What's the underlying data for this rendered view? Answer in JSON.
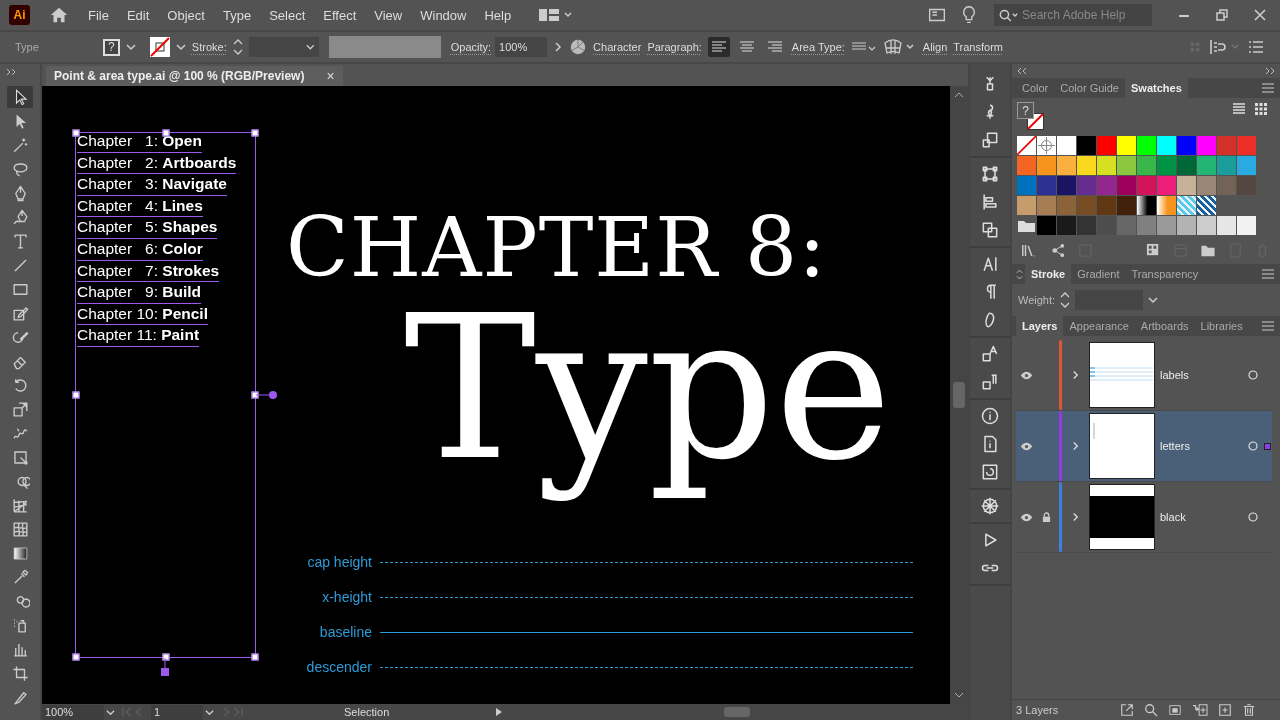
{
  "app_menu": {
    "logo": "Ai",
    "items": [
      "File",
      "Edit",
      "Object",
      "Type",
      "Select",
      "Effect",
      "View",
      "Window",
      "Help"
    ]
  },
  "help_search": {
    "placeholder": "Search Adobe Help"
  },
  "control_bar": {
    "selection_label": "Type",
    "fill_swatch": "?",
    "stroke_label": "Stroke:",
    "opacity_label": "Opacity:",
    "opacity_value": "100%",
    "character": "Character",
    "paragraph_label": "Paragraph:",
    "alignments": [
      {
        "kind": "left",
        "selected": true
      },
      {
        "kind": "center",
        "selected": false
      },
      {
        "kind": "right",
        "selected": false
      }
    ],
    "area_type_label": "Area Type:",
    "align": "Align",
    "transform": "Transform"
  },
  "document_tab": {
    "title": "Point & area type.ai @ 100 % (RGB/Preview)",
    "close": "×"
  },
  "tools": [
    {
      "kind": "selection",
      "selected": true
    },
    {
      "kind": "direct",
      "selected": false
    },
    {
      "kind": "wand",
      "selected": false
    },
    {
      "kind": "lasso",
      "selected": false
    },
    {
      "kind": "pen",
      "selected": false
    },
    {
      "kind": "curvature",
      "selected": false
    },
    {
      "kind": "type",
      "selected": false
    },
    {
      "kind": "line",
      "selected": false
    },
    {
      "kind": "rectangle",
      "selected": false
    },
    {
      "kind": "shaper",
      "selected": false
    },
    {
      "kind": "blob",
      "selected": false
    },
    {
      "kind": "eraser",
      "selected": false
    },
    {
      "kind": "rotate",
      "selected": false
    },
    {
      "kind": "scale",
      "selected": false
    },
    {
      "kind": "warp",
      "selected": false
    },
    {
      "kind": "transform",
      "selected": false
    },
    {
      "kind": "builder",
      "selected": false
    },
    {
      "kind": "perspective",
      "selected": false
    },
    {
      "kind": "mesh",
      "selected": false
    },
    {
      "kind": "gradient",
      "selected": false
    },
    {
      "kind": "eyedropper",
      "selected": false
    },
    {
      "kind": "blend",
      "selected": false
    },
    {
      "kind": "sprayer",
      "selected": false
    },
    {
      "kind": "graph",
      "selected": false
    },
    {
      "kind": "artboard",
      "selected": false
    },
    {
      "kind": "knife",
      "selected": false
    }
  ],
  "canvas": {
    "chapters": [
      "Chapter   1: **Open**",
      "Chapter   2: **Artboards**",
      "Chapter   3: **Navigate**",
      "Chapter   4: **Lines**",
      "Chapter   5: **Shapes**",
      "Chapter   6: **Color**",
      "Chapter   7: **Strokes**",
      "Chapter   9: **Build**",
      "Chapter 10: **Pencil**",
      "Chapter 11: **Paint**"
    ],
    "heading": "CHAPTER 8:",
    "title": "Type",
    "guides": [
      {
        "label": "cap height",
        "kind": "dashed"
      },
      {
        "label": "x-height",
        "kind": "dashed"
      },
      {
        "label": "baseline",
        "kind": "solid"
      },
      {
        "label": "descender",
        "kind": "dashed"
      }
    ]
  },
  "panels": {
    "color_tabs": [
      {
        "label": "Color",
        "selected": false
      },
      {
        "label": "Color Guide",
        "selected": false
      },
      {
        "label": "Swatches",
        "selected": true
      }
    ],
    "fill_swatch": "?",
    "swatches": [
      [
        {
          "kind": "none"
        },
        {
          "kind": "registration"
        },
        {
          "kind": "color",
          "color": "#ffffff"
        },
        {
          "kind": "color",
          "color": "#000000"
        },
        {
          "kind": "color",
          "color": "#ff0000"
        },
        {
          "kind": "color",
          "color": "#ffff00"
        },
        {
          "kind": "color",
          "color": "#00ff00"
        },
        {
          "kind": "color",
          "color": "#00ffff"
        },
        {
          "kind": "color",
          "color": "#0000ff"
        },
        {
          "kind": "color",
          "color": "#ff00ff"
        },
        {
          "kind": "color",
          "color": "#d4302a"
        },
        {
          "kind": "color",
          "color": "#ec2f27"
        }
      ],
      [
        {
          "kind": "color",
          "color": "#f26522"
        },
        {
          "kind": "color",
          "color": "#f7941d"
        },
        {
          "kind": "color",
          "color": "#fbaf3f"
        },
        {
          "kind": "color",
          "color": "#f9d71c"
        },
        {
          "kind": "color",
          "color": "#d7df23"
        },
        {
          "kind": "color",
          "color": "#8dc63f"
        },
        {
          "kind": "color",
          "color": "#39b54a"
        },
        {
          "kind": "color",
          "color": "#009245"
        },
        {
          "kind": "color",
          "color": "#006837"
        },
        {
          "kind": "color",
          "color": "#22b573"
        },
        {
          "kind": "color",
          "color": "#1b9e9b"
        },
        {
          "kind": "color",
          "color": "#29abe2"
        }
      ],
      [
        {
          "kind": "color",
          "color": "#0071bc"
        },
        {
          "kind": "color",
          "color": "#2e3192"
        },
        {
          "kind": "color",
          "color": "#1b1464"
        },
        {
          "kind": "color",
          "color": "#662d91"
        },
        {
          "kind": "color",
          "color": "#93278f"
        },
        {
          "kind": "color",
          "color": "#9e005d"
        },
        {
          "kind": "color",
          "color": "#d4145a"
        },
        {
          "kind": "color",
          "color": "#ed1e79"
        },
        {
          "kind": "color",
          "color": "#c7b299"
        },
        {
          "kind": "color",
          "color": "#998675"
        },
        {
          "kind": "color",
          "color": "#736357"
        },
        {
          "kind": "color",
          "color": "#534741"
        }
      ],
      [
        {
          "kind": "color",
          "color": "#c69c6d"
        },
        {
          "kind": "color",
          "color": "#a67c52"
        },
        {
          "kind": "color",
          "color": "#8c6239"
        },
        {
          "kind": "color",
          "color": "#754c24"
        },
        {
          "kind": "color",
          "color": "#603813"
        },
        {
          "kind": "color",
          "color": "#42210b"
        },
        {
          "kind": "gradient",
          "color": "#000000"
        },
        {
          "kind": "gradient",
          "color": "#f7941d"
        },
        {
          "kind": "pattern",
          "color": "#5bc8ef"
        },
        {
          "kind": "pattern",
          "color": "#1b5e9e"
        }
      ],
      [
        {
          "kind": "folder"
        },
        {
          "kind": "color",
          "color": "#000000"
        },
        {
          "kind": "color",
          "color": "#1a1a1a"
        },
        {
          "kind": "color",
          "color": "#333333"
        },
        {
          "kind": "color",
          "color": "#4d4d4d"
        },
        {
          "kind": "color",
          "color": "#666666"
        },
        {
          "kind": "color",
          "color": "#808080"
        },
        {
          "kind": "color",
          "color": "#999999"
        },
        {
          "kind": "color",
          "color": "#b3b3b3"
        },
        {
          "kind": "color",
          "color": "#cccccc"
        },
        {
          "kind": "color",
          "color": "#e6e6e6"
        },
        {
          "kind": "color",
          "color": "#f2f2f2"
        }
      ]
    ],
    "stroke_tabs": [
      {
        "label": "Stroke",
        "selected": true
      },
      {
        "label": "Gradient",
        "selected": false
      },
      {
        "label": "Transparency",
        "selected": false
      }
    ],
    "weight_label": "Weight:",
    "layer_tabs": [
      {
        "label": "Layers",
        "selected": true
      },
      {
        "label": "Appearance",
        "selected": false
      },
      {
        "label": "Artboards",
        "selected": false
      },
      {
        "label": "Libraries",
        "selected": false
      }
    ],
    "layers": [
      {
        "name": "labels",
        "color": "#e2553b",
        "visible": true,
        "locked": false,
        "selected": false,
        "art_selected": false,
        "kind": "lines"
      },
      {
        "name": "letters",
        "color": "#8f3fe0",
        "visible": true,
        "locked": false,
        "selected": true,
        "art_selected": true,
        "kind": "blank"
      },
      {
        "name": "black",
        "color": "#3f7fe0",
        "visible": true,
        "locked": true,
        "selected": false,
        "art_selected": false,
        "kind": "band"
      }
    ],
    "layer_count": "3 Layers"
  },
  "status_bar": {
    "zoom": "100%",
    "artboard": "1",
    "tool": "Selection"
  }
}
